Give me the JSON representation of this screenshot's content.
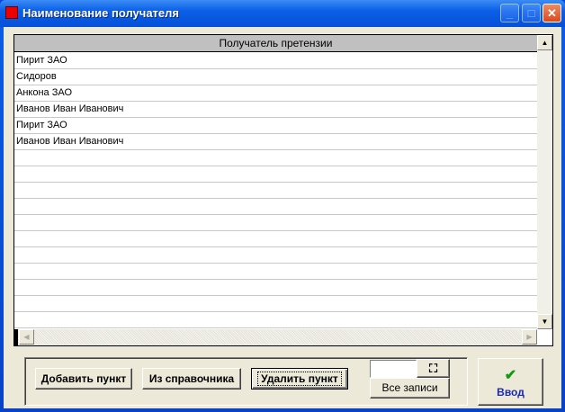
{
  "window": {
    "title": "Наименование получателя",
    "minimize": "_",
    "maximize": "□",
    "close": "✕"
  },
  "grid": {
    "column_header": "Получатель претензии",
    "rows": [
      "Пирит ЗАО",
      "Сидоров",
      "Анкона ЗАО",
      "Иванов Иван Иванович",
      "Пирит ЗАО",
      "Иванов Иван Иванович"
    ],
    "empty_rows": 11
  },
  "buttons": {
    "add": "Добавить пункт",
    "from_directory": "Из справочника",
    "delete": "Удалить пункт",
    "all_records": "Все записи",
    "enter": "Ввод"
  },
  "search": {
    "value": ""
  },
  "icons": {
    "find": "binoculars-icon",
    "enter": "checkmark-icon"
  }
}
